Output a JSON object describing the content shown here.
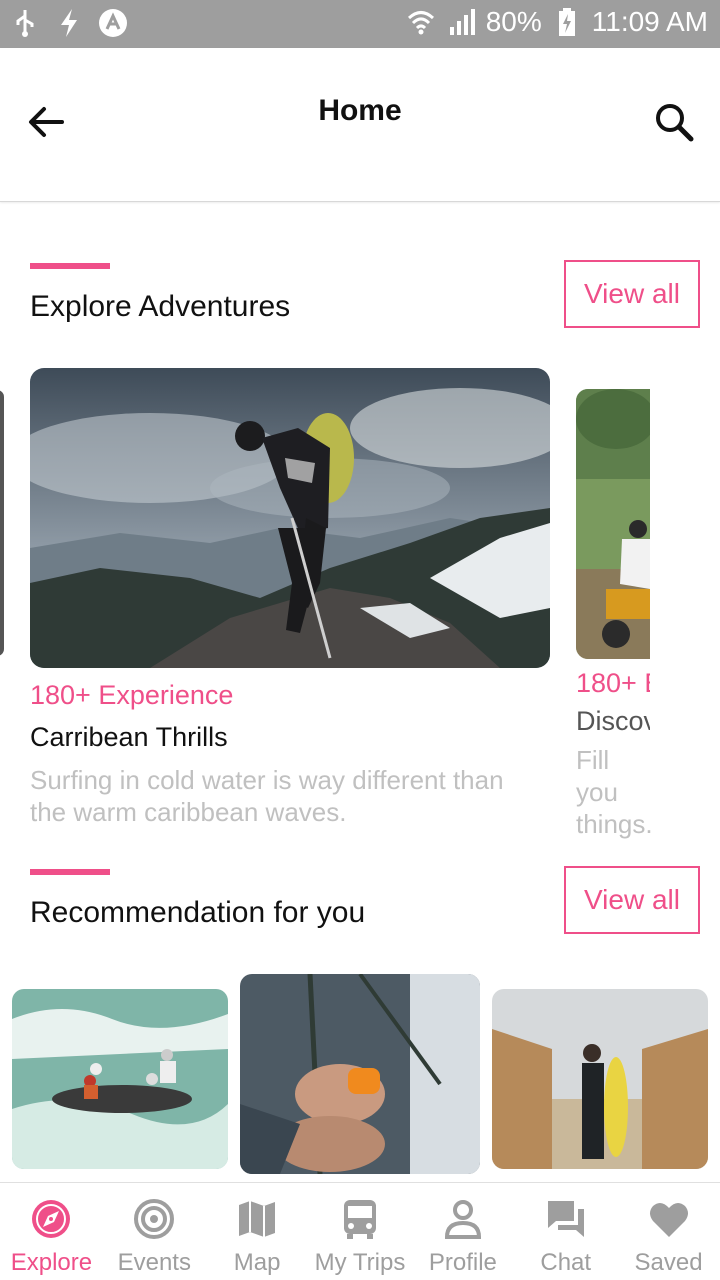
{
  "status_bar": {
    "battery": "80%",
    "time": "11:09 AM",
    "icons": [
      "usb-icon",
      "flash-icon",
      "app-icon",
      "wifi-icon",
      "signal-icon",
      "battery-charging-icon"
    ]
  },
  "header": {
    "title": "Home",
    "back_icon": "back-arrow-icon",
    "search_icon": "search-icon"
  },
  "colors": {
    "accent": "#ef4f89",
    "muted": "#9e9e9e",
    "desc": "#c0c0c0"
  },
  "explore": {
    "title": "Explore Adventures",
    "view_all": "View all",
    "cards": [
      {
        "experience": "180+ Experience",
        "name": "Carribean Thrills",
        "description": "Surfing in cold water is way different than the warm caribbean waves."
      },
      {
        "experience": "180+ E",
        "name": "Discov",
        "description": "Fill you things."
      }
    ]
  },
  "recommendation": {
    "title": "Recommendation for you",
    "view_all": "View all"
  },
  "bottom_nav": {
    "items": [
      {
        "label": "Explore",
        "icon": "compass-icon",
        "active": true
      },
      {
        "label": "Events",
        "icon": "target-icon",
        "active": false
      },
      {
        "label": "Map",
        "icon": "map-icon",
        "active": false
      },
      {
        "label": "My Trips",
        "icon": "bus-icon",
        "active": false
      },
      {
        "label": "Profile",
        "icon": "person-icon",
        "active": false
      },
      {
        "label": "Chat",
        "icon": "chat-icon",
        "active": false
      },
      {
        "label": "Saved",
        "icon": "heart-icon",
        "active": false
      }
    ]
  }
}
